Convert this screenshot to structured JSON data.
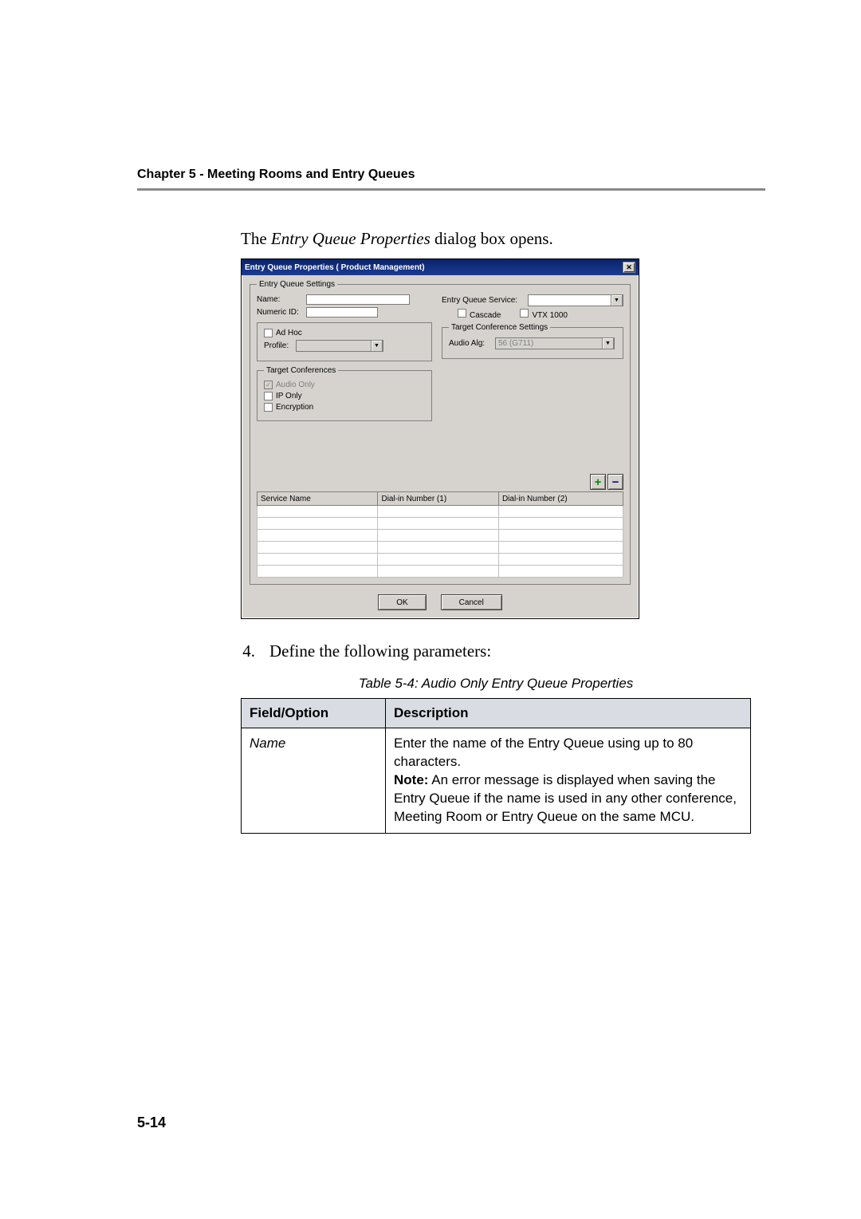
{
  "header": {
    "text": "Chapter 5 - Meeting Rooms and Entry Queues"
  },
  "intro": {
    "pre": "The ",
    "ital": "Entry Queue Properties",
    "post": " dialog box opens."
  },
  "dlg": {
    "title": "Entry Queue Properties ( Product Management)",
    "close": "✕",
    "eqSettings": {
      "legend": "Entry Queue Settings",
      "nameLabel": "Name:",
      "nameValue": "",
      "numIdLabel": "Numeric ID:",
      "numIdValue": "",
      "eqServiceLabel": "Entry Queue Service:",
      "cascade": "Cascade",
      "vtx": "VTX 1000"
    },
    "adhoc": {
      "adhoc": "Ad Hoc",
      "profileLabel": "Profile:"
    },
    "tcs": {
      "legend": "Target Conference Settings",
      "audioAlgLabel": "Audio Alg:",
      "audioAlgValue": "56 (G711)"
    },
    "tc": {
      "legend": "Target Conferences",
      "audioOnly": "Audio Only",
      "ipOnly": "IP Only",
      "encryption": "Encryption"
    },
    "plus": "+",
    "minus": "−",
    "grid": {
      "c1": "Service Name",
      "c2": "Dial-in Number (1)",
      "c3": "Dial-in Number (2)"
    },
    "ok": "OK",
    "cancel": "Cancel"
  },
  "step": {
    "n": "4.",
    "text": "Define the following parameters:"
  },
  "caption": "Table 5-4: Audio Only Entry Queue Properties",
  "props": {
    "h1": "Field/Option",
    "h2": "Description",
    "r1": {
      "field": "Name",
      "line1": "Enter the name of the Entry Queue using up to 80 characters.",
      "noteBold": "Note:",
      "note": " An error message is displayed when saving the Entry Queue if the name is used in any other conference, Meeting Room or Entry Queue on the same MCU."
    }
  },
  "pageno": "5-14"
}
